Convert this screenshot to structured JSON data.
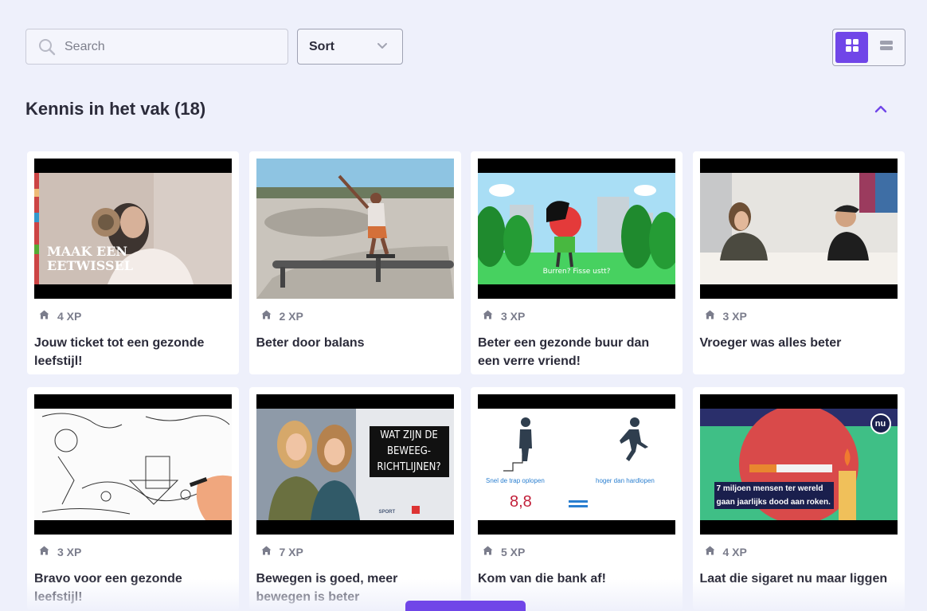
{
  "search": {
    "placeholder": "Search",
    "value": ""
  },
  "sort": {
    "label": "Sort"
  },
  "view_toggle": {
    "active": "grid",
    "accent": "#7046e8"
  },
  "section": {
    "title": "Kennis in het vak (18)"
  },
  "cards": [
    {
      "xp": "4 XP",
      "title": "Jouw ticket tot een gezonde leefstijl!",
      "thumb_text": "MAAK EEN EETWISSEL"
    },
    {
      "xp": "2 XP",
      "title": "Beter door balans",
      "thumb_text": ""
    },
    {
      "xp": "3 XP",
      "title": "Beter een gezonde buur dan een verre vriend!",
      "thumb_text": "Burren? Fisse ustt?"
    },
    {
      "xp": "3 XP",
      "title": "Vroeger was alles beter",
      "thumb_text": ""
    },
    {
      "xp": "3 XP",
      "title": "Bravo voor een gezonde leefstijl!",
      "thumb_text": ""
    },
    {
      "xp": "7 XP",
      "title": "Bewegen is goed, meer bewegen is beter",
      "thumb_text": "WAT ZIJN DE BEWEEG-RICHTLIJNEN?",
      "thumb_footer": "SPORT"
    },
    {
      "xp": "5 XP",
      "title": "Kom van die bank af!",
      "thumb_text": "Snel de trap oplopen",
      "thumb_text2": "hoger dan hardlopen",
      "thumb_value": "8,8",
      "thumb_symbol": "="
    },
    {
      "xp": "4 XP",
      "title": "Laat die sigaret nu maar liggen",
      "thumb_text": "7 miljoen mensen ter wereld gaan jaarlijks dood aan roken.",
      "thumb_badge": "nu"
    }
  ]
}
